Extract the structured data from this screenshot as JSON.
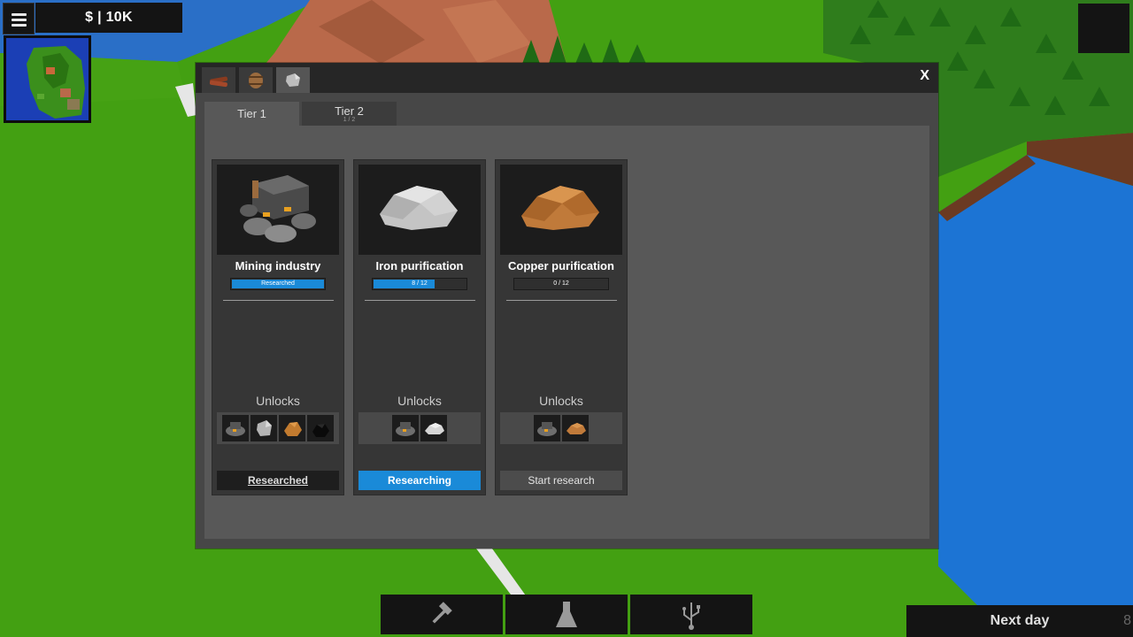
{
  "hud": {
    "menu_icon": "hamburger-menu-icon",
    "money": "$ | 10K"
  },
  "panel": {
    "category_tabs": [
      {
        "icon": "wood-logs-icon"
      },
      {
        "icon": "barrel-icon"
      },
      {
        "icon": "stone-icon"
      }
    ],
    "close_label": "X",
    "tier_tabs": [
      {
        "label": "Tier 1",
        "sub": ""
      },
      {
        "label": "Tier 2",
        "sub": "1 / 2"
      }
    ],
    "cards": [
      {
        "title": "Mining industry",
        "progress_text": "Researched",
        "progress_fraction": 1.0,
        "unlocks_label": "Unlocks",
        "unlock_icons": [
          "mine-icon",
          "stone-ore-icon",
          "copper-ore-icon",
          "coal-icon"
        ],
        "button": "Researched"
      },
      {
        "title": "Iron purification",
        "progress_text": "8 / 12",
        "progress_fraction": 0.667,
        "unlocks_label": "Unlocks",
        "unlock_icons": [
          "mine-icon",
          "iron-pile-icon"
        ],
        "button": "Researching"
      },
      {
        "title": "Copper purification",
        "progress_text": "0 / 12",
        "progress_fraction": 0,
        "unlocks_label": "Unlocks",
        "unlock_icons": [
          "mine-icon",
          "copper-pile-icon"
        ],
        "button": "Start research"
      }
    ]
  },
  "toolbar": [
    {
      "icon": "hammer-icon"
    },
    {
      "icon": "flask-icon"
    },
    {
      "icon": "usb-network-icon"
    }
  ],
  "next_day": {
    "label": "Next day",
    "counter": "8"
  },
  "colors": {
    "accent": "#1a8ad8",
    "panel": "#474747",
    "grass": "#3f9a10",
    "water": "#1c74d4"
  }
}
